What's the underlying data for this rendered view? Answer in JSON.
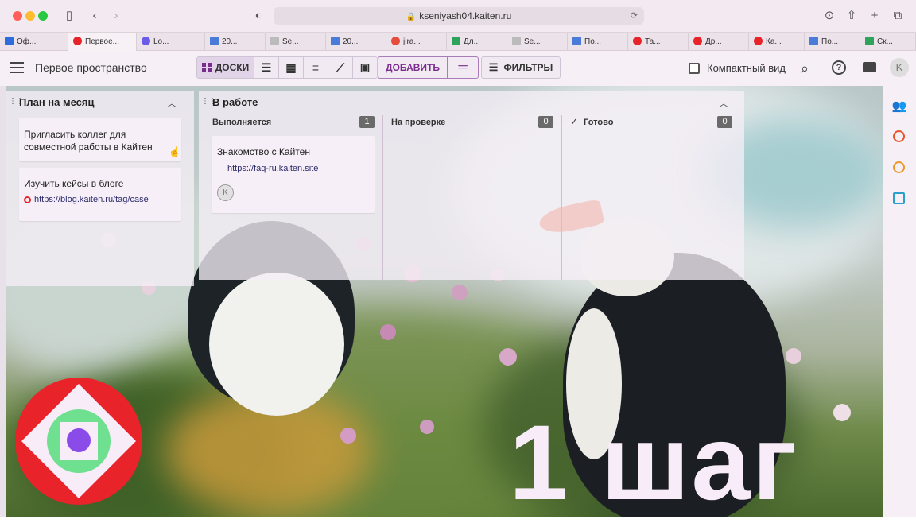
{
  "browser": {
    "url": "kseniyash04.kaiten.ru",
    "tabs": [
      "Оф...",
      "Первое...",
      "Lo...",
      "20...",
      "Se...",
      "20...",
      "jira...",
      "Дл...",
      "Se...",
      "По...",
      "Та...",
      "Др...",
      "Ка...",
      "По...",
      "Ск..."
    ]
  },
  "header": {
    "space_title": "Первое пространство",
    "boards_label": "ДОСКИ",
    "add_label": "ДОБАВИТЬ",
    "filters_label": "ФИЛЬТРЫ",
    "compact_label": "Компактный вид",
    "avatar_letter": "K"
  },
  "board": {
    "column1": {
      "title": "План на месяц",
      "cards": [
        {
          "title": "Пригласить коллег для совместной работы в Кайтен"
        },
        {
          "title": "Изучить кейсы в блоге",
          "link": "https://blog.kaiten.ru/tag/case"
        }
      ]
    },
    "column2": {
      "title": "В работе",
      "subcolumns": [
        {
          "title": "Выполняется",
          "count": "1"
        },
        {
          "title": "На проверке",
          "count": "0"
        },
        {
          "title": "Готово",
          "count": "0"
        }
      ],
      "card": {
        "title": "Знакомство с Кайтен",
        "link": "https://faq-ru.kaiten.site",
        "avatar": "K"
      }
    }
  },
  "overlay": {
    "step_text": "1 шаг"
  },
  "colors": {
    "accent": "#7b2d8e",
    "logo_red": "#e8232a",
    "logo_green": "#6fe08f",
    "logo_purple": "#8b4be8"
  }
}
